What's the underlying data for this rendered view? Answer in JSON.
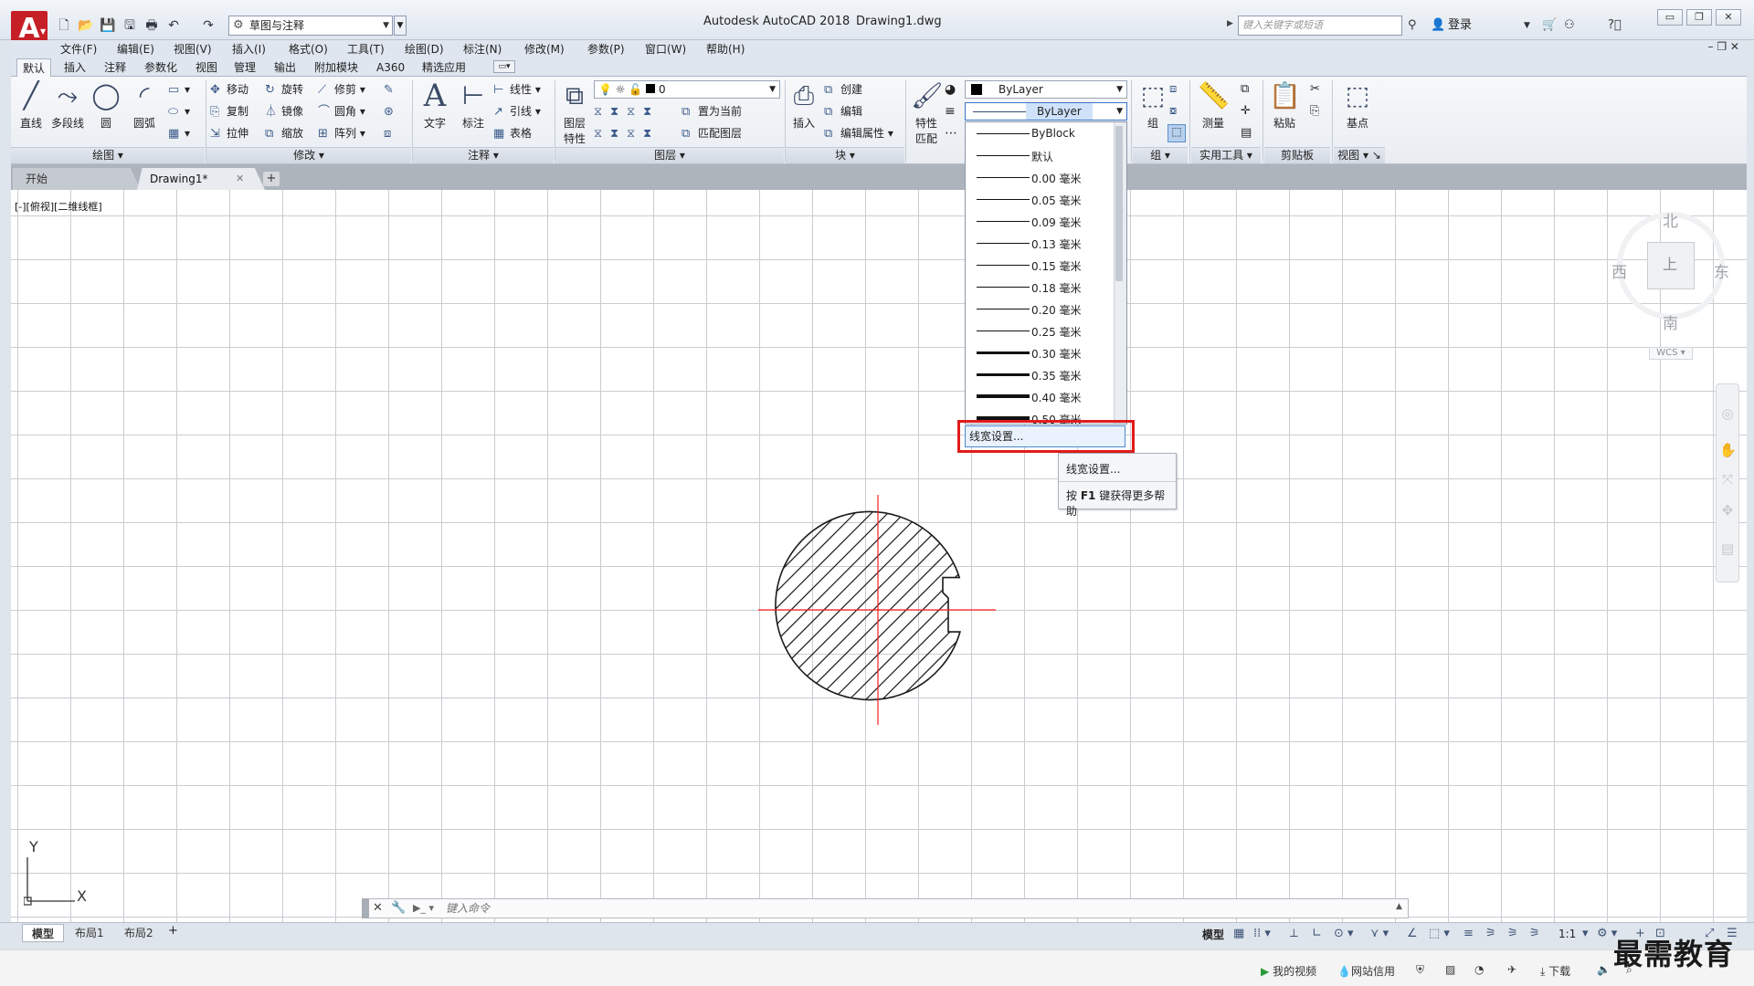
{
  "titlebar": {
    "logo": "A",
    "workspace": "草图与注释",
    "app_title": "Autodesk AutoCAD 2018",
    "doc_title": "Drawing1.dwg",
    "search_placeholder": "键入关键字或短语",
    "login": "登录"
  },
  "menubar": [
    "文件(F)",
    "编辑(E)",
    "视图(V)",
    "插入(I)",
    "格式(O)",
    "工具(T)",
    "绘图(D)",
    "标注(N)",
    "修改(M)",
    "参数(P)",
    "窗口(W)",
    "帮助(H)"
  ],
  "ribbon_tabs": [
    "默认",
    "插入",
    "注释",
    "参数化",
    "视图",
    "管理",
    "输出",
    "附加模块",
    "A360",
    "精选应用"
  ],
  "ribbon": {
    "draw": {
      "title": "绘图",
      "tools": [
        "直线",
        "多段线",
        "圆",
        "圆弧"
      ]
    },
    "modify": {
      "title": "修改",
      "tools": [
        "移动",
        "旋转",
        "修剪",
        "复制",
        "镜像",
        "圆角",
        "拉伸",
        "缩放",
        "阵列"
      ]
    },
    "annotation": {
      "title": "注释",
      "tools": [
        "文字",
        "标注",
        "线性",
        "引线",
        "表格"
      ]
    },
    "layers": {
      "title": "图层",
      "big": "图层\n特性",
      "layer_value": "0",
      "tools": [
        "置为当前",
        "匹配图层"
      ]
    },
    "block": {
      "title": "块",
      "big": "插入",
      "tools": [
        "创建",
        "编辑",
        "编辑属性"
      ]
    },
    "properties": {
      "big": "特性\n匹配",
      "color": "ByLayer"
    },
    "groups": {
      "title": "组",
      "big": "组"
    },
    "utilities": {
      "title": "实用工具",
      "big": "测量"
    },
    "clipboard": {
      "title": "剪贴板",
      "big": "粘贴"
    },
    "view": {
      "title": "视图",
      "big": "基点"
    }
  },
  "doc_tabs": {
    "start": "开始",
    "drawing": "Drawing1*"
  },
  "viewport_label": "[-][俯视][二维线框]",
  "viewcube": {
    "north": "北",
    "south": "南",
    "east": "东",
    "west": "西",
    "top": "上",
    "wcs": "WCS"
  },
  "lineweight_dropdown": {
    "selected": "ByLayer",
    "options": [
      {
        "label": "ByBlock",
        "weight": 1
      },
      {
        "label": "默认",
        "weight": 1
      },
      {
        "label": "0.00 毫米",
        "weight": 1
      },
      {
        "label": "0.05 毫米",
        "weight": 1
      },
      {
        "label": "0.09 毫米",
        "weight": 1
      },
      {
        "label": "0.13 毫米",
        "weight": 1
      },
      {
        "label": "0.15 毫米",
        "weight": 1
      },
      {
        "label": "0.18 毫米",
        "weight": 1
      },
      {
        "label": "0.20 毫米",
        "weight": 1
      },
      {
        "label": "0.25 毫米",
        "weight": 1
      },
      {
        "label": "0.30 毫米",
        "weight": 3
      },
      {
        "label": "0.35 毫米",
        "weight": 3
      },
      {
        "label": "0.40 毫米",
        "weight": 4
      },
      {
        "label": "0.50 毫米",
        "weight": 5
      }
    ],
    "settings": "线宽设置..."
  },
  "tooltip": {
    "title": "线宽设置...",
    "help_prefix": "按 ",
    "help_key": "F1",
    "help_suffix": " 键获得更多帮助"
  },
  "ucs": {
    "x": "X",
    "y": "Y"
  },
  "command_line": {
    "placeholder": "键入命令"
  },
  "layout_tabs": [
    "模型",
    "布局1",
    "布局2"
  ],
  "status": {
    "model": "模型",
    "scale": "1:1"
  },
  "bottom_strip": {
    "video": "我的视频",
    "credit": "网站信用",
    "download": "下载"
  },
  "watermark": "最需教育",
  "colors": {
    "accent_red": "#e01b1b",
    "crosshair": "#ff0000",
    "selection": "#cfe2fa"
  }
}
